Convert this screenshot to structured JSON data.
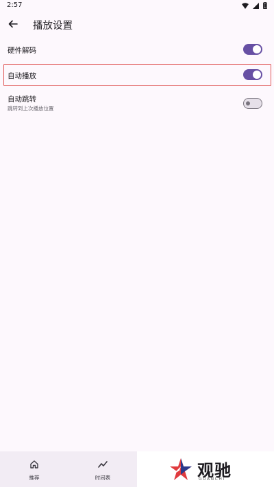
{
  "status_bar": {
    "time": "2:57"
  },
  "header": {
    "title": "播放设置"
  },
  "settings": [
    {
      "label": "硬件解码",
      "sublabel": "",
      "enabled": true
    },
    {
      "label": "自动播放",
      "sublabel": "",
      "enabled": true
    },
    {
      "label": "自动跳转",
      "sublabel": "跳转到上次播放位置",
      "enabled": false
    }
  ],
  "bottom_nav": {
    "items": [
      {
        "label": "推荐",
        "icon": "home-icon"
      },
      {
        "label": "时间表",
        "icon": "trend-icon"
      }
    ]
  },
  "watermark": {
    "text": "观驰",
    "subtext": "GUANCHI"
  },
  "colors": {
    "accent": "#6750a4",
    "highlight": "#e05757",
    "background": "#fdf8fd"
  }
}
